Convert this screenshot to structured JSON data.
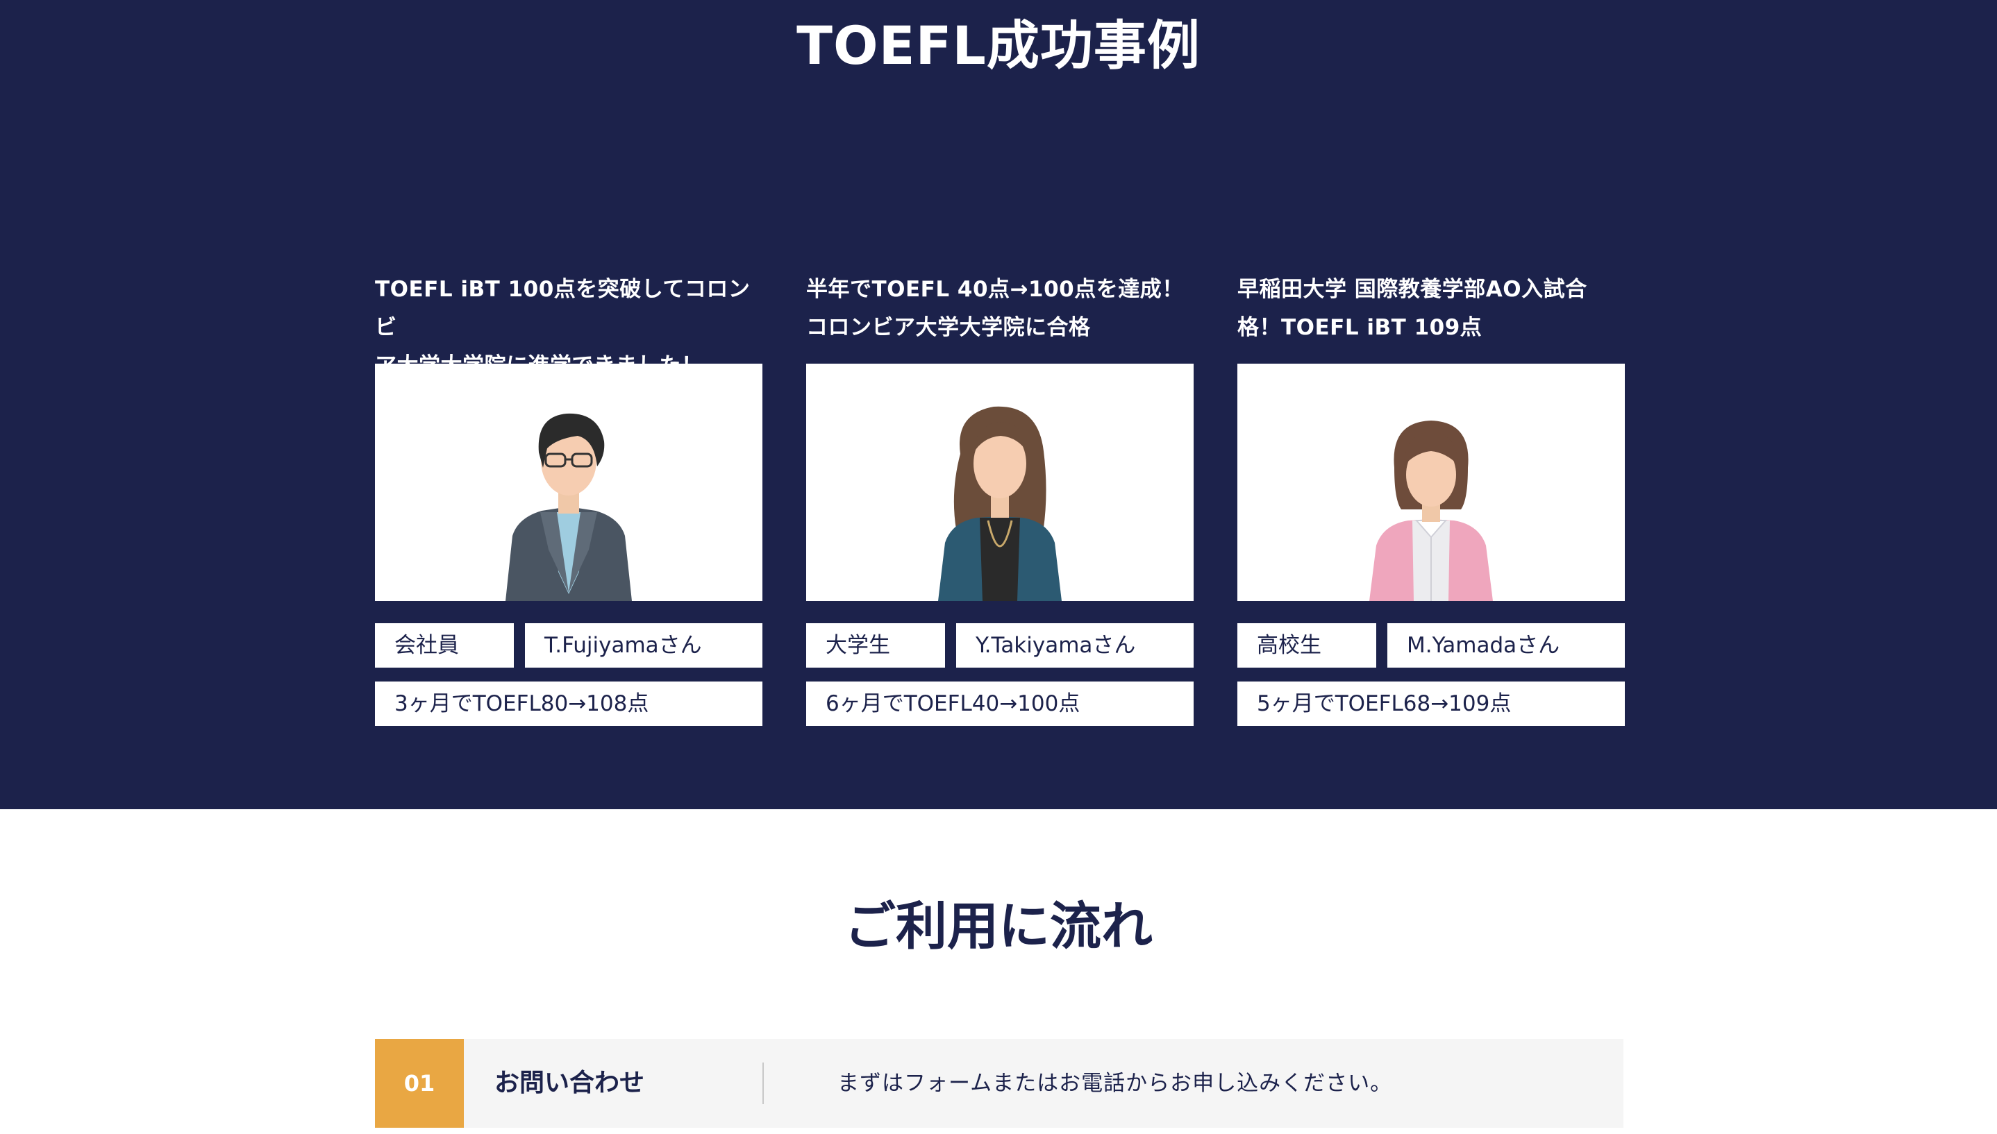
{
  "success_section": {
    "title": "TOEFL成功事例",
    "cases": [
      {
        "headline_line1": "TOEFL iBT 100点を突破してコロンビ",
        "headline_line2": "ア大学大学院に進学できました！",
        "role": "会社員",
        "name": "T.Fujiyamaさん",
        "result": "3ヶ月でTOEFL80→108点",
        "avatar": "businessman-with-glasses-icon"
      },
      {
        "headline_line1": "半年でTOEFL 40点→100点を達成！",
        "headline_line2": "コロンビア大学大学院に合格",
        "role": "大学生",
        "name": "Y.Takiyamaさん",
        "result": "6ヶ月でTOEFL40→100点",
        "avatar": "woman-long-hair-icon"
      },
      {
        "headline_line1": "早稲田大学 国際教養学部AO入試合",
        "headline_line2": "格！TOEFL iBT 109点",
        "role": "高校生",
        "name": "M.Yamadaさん",
        "result": "5ヶ月でTOEFL68→109点",
        "avatar": "girl-bob-hair-icon"
      }
    ]
  },
  "flow_section": {
    "title": "ご利用に流れ",
    "steps": [
      {
        "number": "01",
        "label": "お問い合わせ",
        "description": "まずはフォームまたはお電話からお申し込みください。"
      }
    ]
  },
  "colors": {
    "navy": "#1c224b",
    "accent": "#e9a743",
    "step_bg": "#f5f5f5"
  }
}
